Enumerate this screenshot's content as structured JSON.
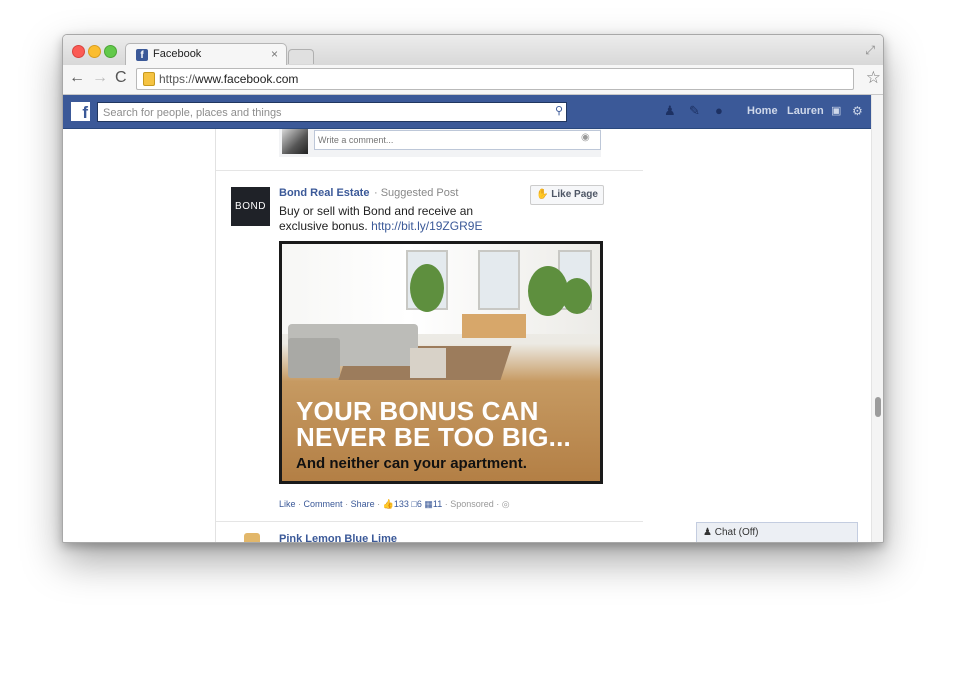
{
  "browser": {
    "tab_title": "Facebook",
    "tab_close": "×",
    "url_proto": "https://",
    "url_host": "www.facebook.com",
    "back_icon": "←",
    "forward_icon": "→",
    "reload_icon": "C",
    "star_icon": "☆",
    "expand_icon": "⤢"
  },
  "fb_header": {
    "logo": "f",
    "search_placeholder": "Search for people, places and things",
    "nav_home": "Home",
    "nav_profile": "Lauren",
    "icons": [
      "friend-requests-icon",
      "messages-icon",
      "notifications-icon",
      "privacy-shortcuts-icon",
      "settings-gear-icon"
    ]
  },
  "comment_box": {
    "placeholder": "Write a comment..."
  },
  "post": {
    "logo_text": "BOND",
    "page_name": "Bond Real Estate",
    "meta": "· Suggested Post",
    "like_page_label": "Like Page",
    "text_line1": "Buy or sell with Bond and receive an",
    "text_line2": "exclusive bonus.",
    "link": "http://bit.ly/19ZGR9E",
    "ad_headline_line1": "YOUR BONUS CAN",
    "ad_headline_line2": "NEVER BE TOO BIG...",
    "ad_subline": "And neither can your apartment.",
    "actions": {
      "like": "Like",
      "comment": "Comment",
      "share": "Share",
      "likes_count": "133",
      "comments_count": "6",
      "shares_count": "11",
      "sponsored": "Sponsored"
    }
  },
  "next_post": {
    "page_name": "Pink Lemon Blue Lime"
  },
  "chat": {
    "label": "Chat (Off)"
  },
  "colors": {
    "facebook_blue": "#3b5998",
    "link_blue": "#3b5998"
  }
}
